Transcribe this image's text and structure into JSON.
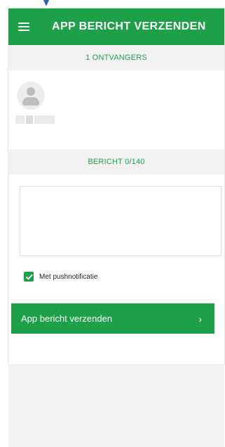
{
  "header": {
    "title": "APP BERICHT VERZENDEN",
    "menu_icon": "hamburger-menu-icon"
  },
  "recipients_bar": {
    "label": "1 ONTVANGERS"
  },
  "message_bar": {
    "label": "BERICHT 0/140"
  },
  "message": {
    "value": "",
    "placeholder": ""
  },
  "push": {
    "checked": true,
    "label": "Met pushnotificatie"
  },
  "send_button": {
    "label": "App bericht verzenden",
    "chevron": "›"
  },
  "colors": {
    "accent": "#1ea048",
    "bar_bg": "#f1f1f1",
    "bottom_bg": "#f2f2f2"
  }
}
